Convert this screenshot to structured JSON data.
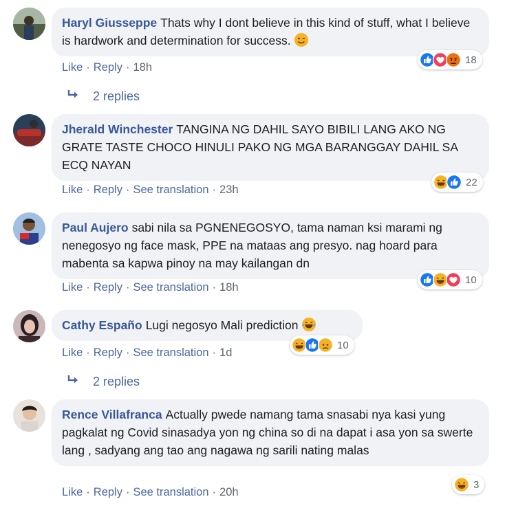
{
  "comments": [
    {
      "author": "Haryl Giusseppe",
      "text": "Thats why I dont believe in this kind of stuff, what I believe is hardwork and determination for success.",
      "actions": {
        "like": "Like",
        "reply": "Reply",
        "time": "18h"
      },
      "reactions": {
        "icons": [
          "like-icon",
          "love-icon",
          "angry-icon"
        ],
        "count": "18"
      },
      "replies_label": "2 replies"
    },
    {
      "author": "Jherald Winchester",
      "text": "TANGINA NG DAHIL SAYO BIBILI LANG AKO NG GRATE TASTE CHOCO HINULI PAKO NG MGA BARANGGAY DAHIL SA ECQ NAYAN",
      "actions": {
        "like": "Like",
        "reply": "Reply",
        "translate": "See translation",
        "time": "23h"
      },
      "reactions": {
        "icons": [
          "haha-icon",
          "like-icon"
        ],
        "count": "22"
      }
    },
    {
      "author": "Paul Aujero",
      "text": "sabi nila sa PGNENEGOSYO, tama naman ksi marami ng nenegosyo ng face mask, PPE na mataas ang presyo. nag hoard para mabenta sa kapwa pinoy na may kailangan dn",
      "actions": {
        "like": "Like",
        "reply": "Reply",
        "translate": "See translation",
        "time": "18h"
      },
      "reactions": {
        "icons": [
          "like-icon",
          "haha-icon",
          "love-icon"
        ],
        "count": "10"
      }
    },
    {
      "author": "Cathy Españo",
      "text": "Lugi negosyo Mali prediction",
      "actions": {
        "like": "Like",
        "reply": "Reply",
        "translate": "See translation",
        "time": "1d"
      },
      "reactions": {
        "icons": [
          "haha-icon",
          "like-icon",
          "sad-icon"
        ],
        "count": "10"
      },
      "replies_label": "2 replies"
    },
    {
      "author": "Rence Villafranca",
      "text": "Actually pwede namang tama snasabi nya kasi yung pagkalat ng Covid sinasadya yon ng china so di na dapat i asa yon sa swerte lang , sadyang ang tao ang nagawa ng sarili nating malas",
      "actions": {
        "like": "Like",
        "reply": "Reply",
        "translate": "See translation",
        "time": "20h"
      },
      "reactions": {
        "icons": [
          "haha-icon"
        ],
        "count": "3"
      }
    }
  ],
  "colors": {
    "author": "#385898",
    "link": "#4b67a1",
    "bubble": "#f0f2f5",
    "like": "#1877f2",
    "love": "#f33e58",
    "haha": "#f7b125",
    "angry": "#e9710f"
  }
}
